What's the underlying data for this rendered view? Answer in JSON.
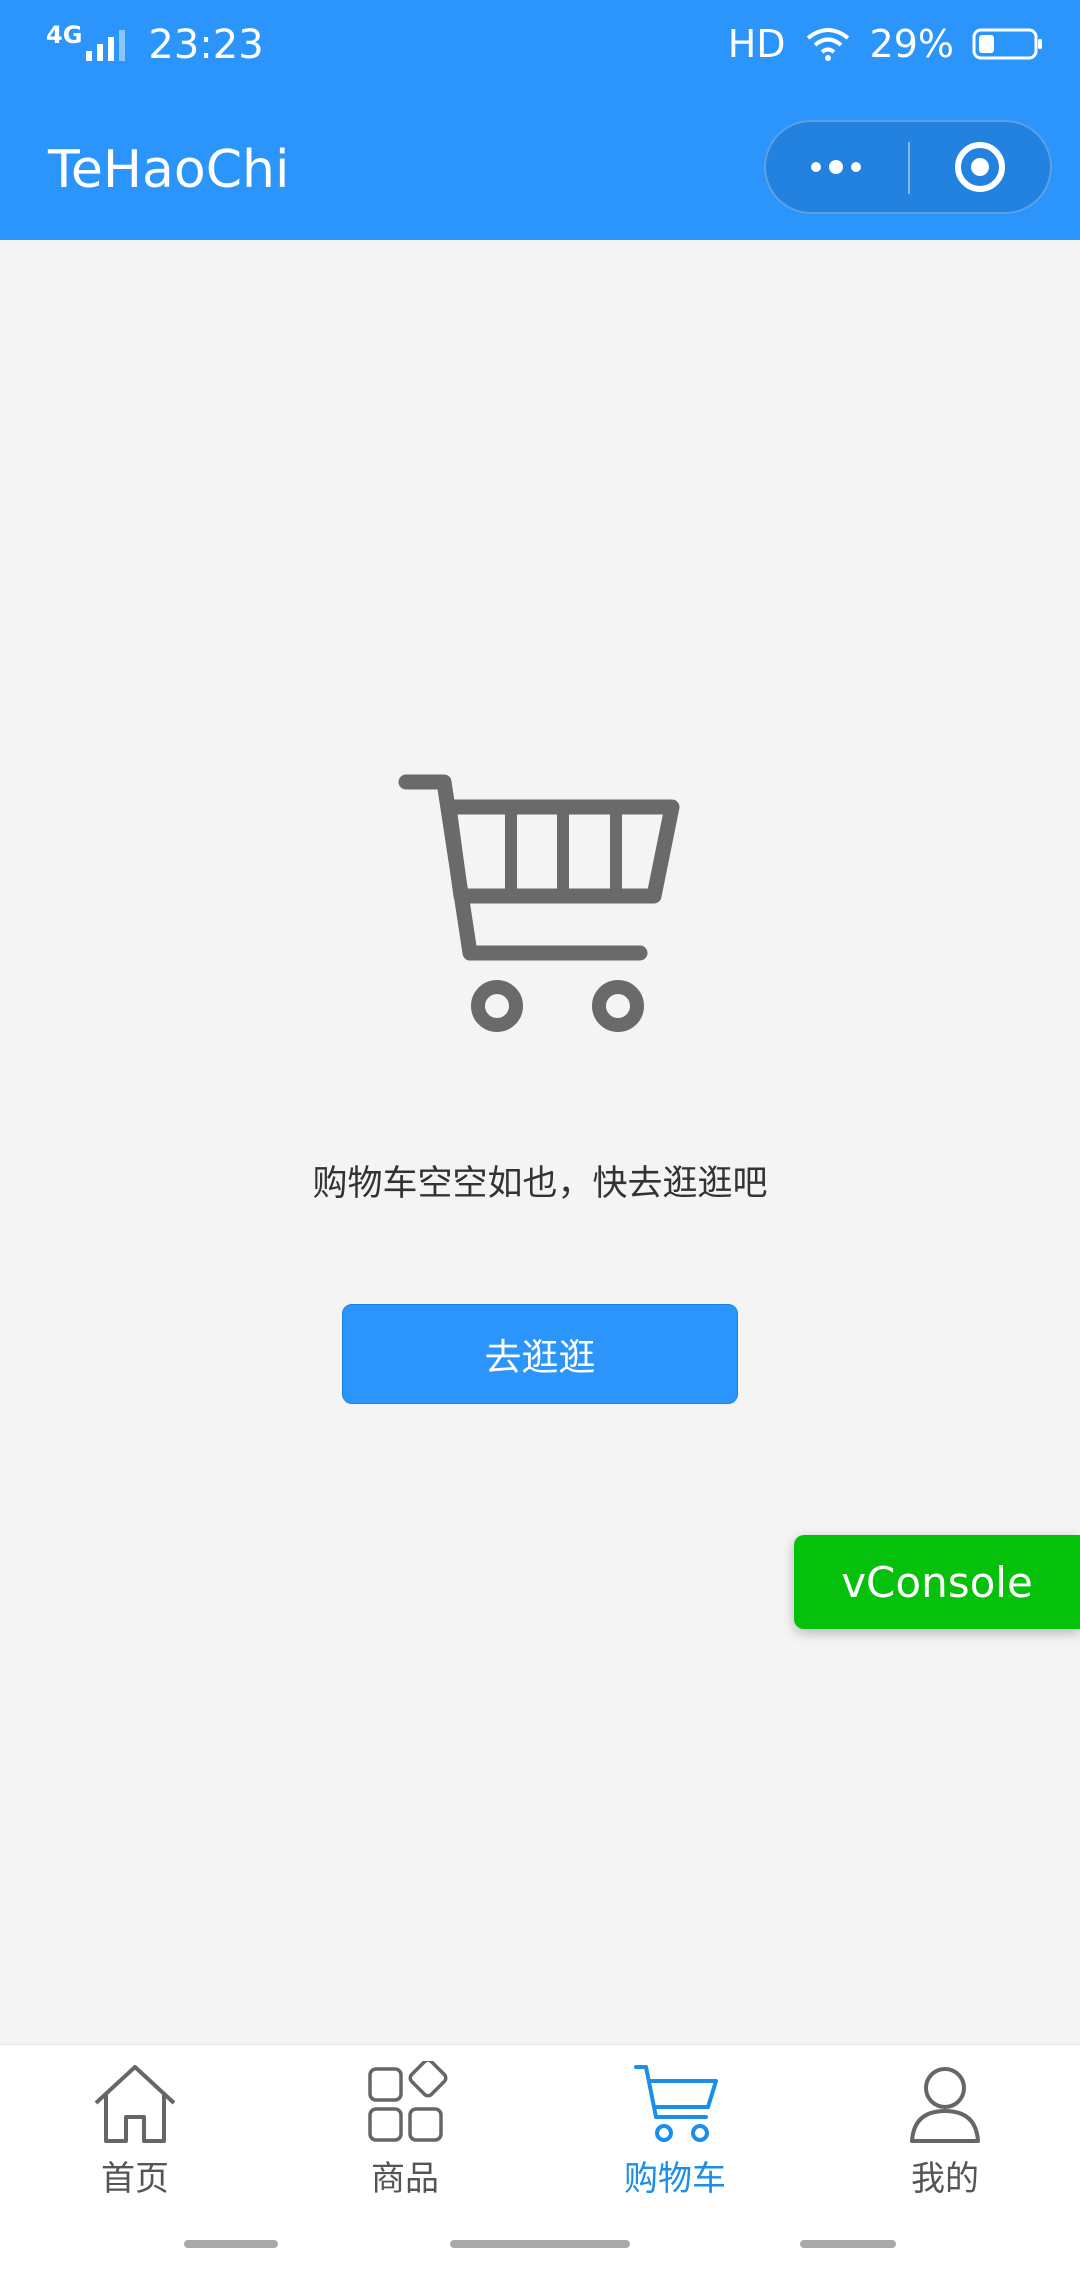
{
  "status_bar": {
    "network": "4G",
    "time": "23:23",
    "hd": "HD",
    "battery": "29%",
    "battery_level": 0.29
  },
  "navbar": {
    "title": "TeHaoChi",
    "capsule_icons": [
      "more-dots-icon",
      "target-icon"
    ]
  },
  "cart": {
    "icon": "shopping-cart-icon",
    "empty_message": "购物车空空如也，快去逛逛吧",
    "go_button": "去逛逛"
  },
  "vconsole": {
    "label": "vConsole"
  },
  "tabbar": {
    "tabs": [
      {
        "label": "首页",
        "icon": "home-icon",
        "active": false
      },
      {
        "label": "商品",
        "icon": "grid-icon",
        "active": false
      },
      {
        "label": "购物车",
        "icon": "cart-icon",
        "active": true
      },
      {
        "label": "我的",
        "icon": "person-icon",
        "active": false
      }
    ]
  },
  "colors": {
    "header_blue": "#2b95fb",
    "active_tab": "#1a8ee8",
    "vconsole_green": "#06c10b",
    "cart_gray": "#6a6a6a"
  }
}
